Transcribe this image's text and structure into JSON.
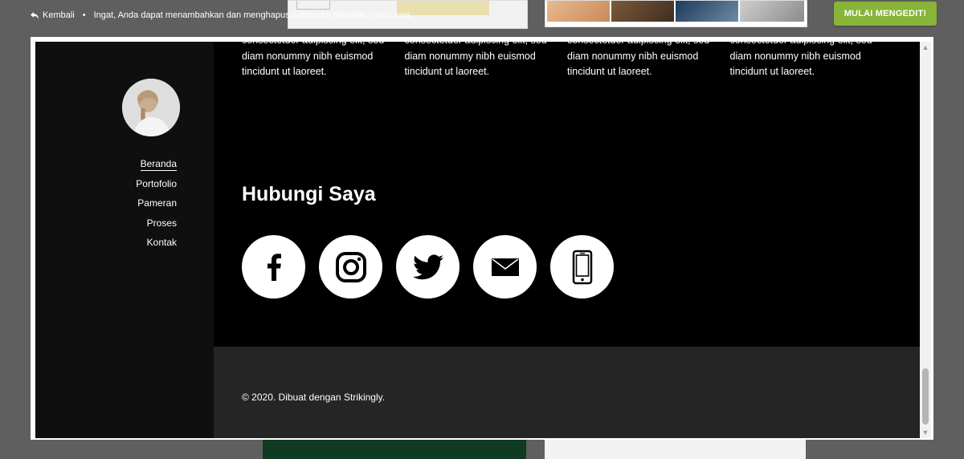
{
  "topbar": {
    "back_label": "Kembali",
    "bullet": "•",
    "hint": "Ingat, Anda dapat menambahkan dan menghapus bagian ke template mana saja.",
    "start_button": "MULAI MENGEDIT!"
  },
  "colors": {
    "start_button": "#88b43a",
    "page_background": "#000000",
    "sidebar_background": "#0f0f0f",
    "footer_background": "#252525"
  },
  "sidebar": {
    "nav": [
      {
        "label": "Beranda",
        "active": true
      },
      {
        "label": "Portofolio",
        "active": false
      },
      {
        "label": "Pameran",
        "active": false
      },
      {
        "label": "Proses",
        "active": false
      },
      {
        "label": "Kontak",
        "active": false
      }
    ]
  },
  "content": {
    "columns": [
      {
        "text": "consectetuer adipiscing elit, sed diam nonummy nibh euismod tincidunt ut laoreet."
      },
      {
        "text": "consectetuer adipiscing elit, sed diam nonummy nibh euismod tincidunt ut laoreet."
      },
      {
        "text": "consectetuer adipiscing elit, sed diam nonummy nibh euismod tincidunt ut laoreet."
      },
      {
        "text": "consectetuer adipiscing elit, sed diam nonummy nibh euismod tincidunt ut laoreet."
      }
    ],
    "contact_title": "Hubungi Saya",
    "social_icons": [
      "facebook-icon",
      "instagram-icon",
      "twitter-icon",
      "email-icon",
      "phone-icon"
    ]
  },
  "footer": {
    "text": "© 2020. Dibuat dengan Strikingly."
  }
}
